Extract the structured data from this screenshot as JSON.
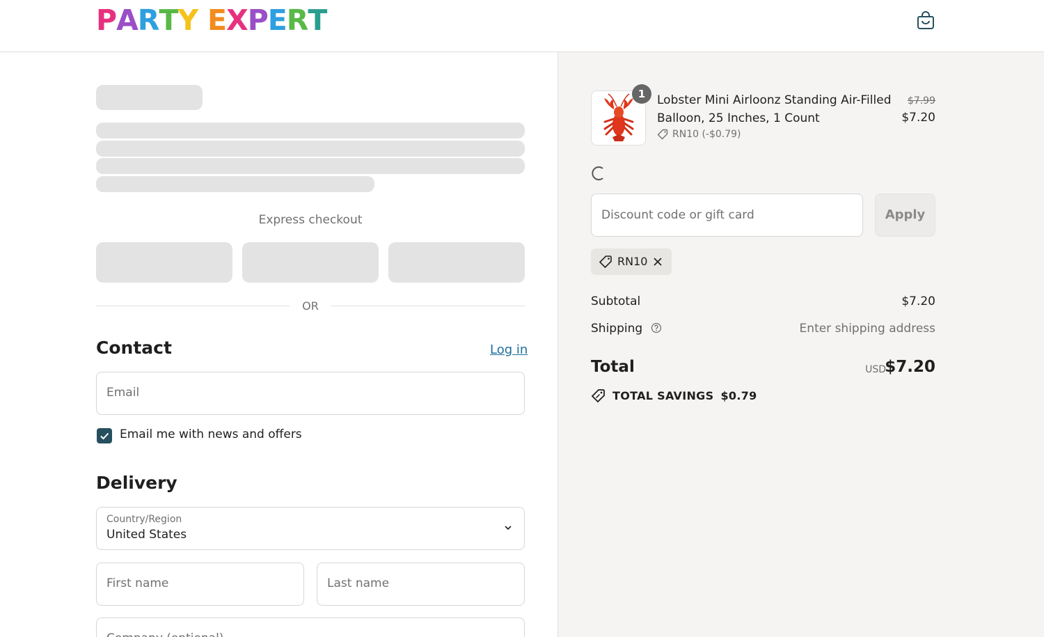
{
  "header": {
    "logo_letters": [
      {
        "ch": "P",
        "color": "#e8317e"
      },
      {
        "ch": "A",
        "color": "#9a4fc7"
      },
      {
        "ch": "R",
        "color": "#2e9fe0"
      },
      {
        "ch": "T",
        "color": "#58b947"
      },
      {
        "ch": "Y",
        "color": "#f5c21b"
      },
      {
        "ch": " ",
        "color": "#ffffff"
      },
      {
        "ch": "E",
        "color": "#f28c1e"
      },
      {
        "ch": "X",
        "color": "#e8317e"
      },
      {
        "ch": "P",
        "color": "#9a4fc7"
      },
      {
        "ch": "E",
        "color": "#2e9fe0"
      },
      {
        "ch": "R",
        "color": "#58b947"
      },
      {
        "ch": "T",
        "color": "#2a9d8f"
      }
    ],
    "cart_icon": "shopping-bag-icon"
  },
  "express": {
    "label": "Express checkout",
    "or_label": "OR"
  },
  "contact": {
    "title": "Contact",
    "login_link": "Log in",
    "email_placeholder": "Email",
    "newsletter_label": "Email me with news and offers",
    "newsletter_checked": true
  },
  "delivery": {
    "title": "Delivery",
    "country_label": "Country/Region",
    "country_value": "United States",
    "first_name_placeholder": "First name",
    "last_name_placeholder": "Last name",
    "company_placeholder": "Company (optional)"
  },
  "order": {
    "item": {
      "quantity": "1",
      "name": "Lobster Mini Airloonz Standing Air-Filled Balloon, 25 Inches, 1 Count",
      "discount_line": "RN10 (-$0.79)",
      "price_original": "$7.99",
      "price_final": "$7.20"
    },
    "discount_placeholder": "Discount code or gift card",
    "apply_label": "Apply",
    "applied_code": "RN10",
    "subtotal_label": "Subtotal",
    "subtotal_value": "$7.20",
    "shipping_label": "Shipping",
    "shipping_value": "Enter shipping address",
    "total_label": "Total",
    "total_currency": "USD",
    "total_value": "$7.20",
    "savings_label": "TOTAL SAVINGS",
    "savings_value": "$0.79"
  },
  "colors": {
    "accent_checkbox": "#26505f",
    "link": "#1d6e9a",
    "right_bg": "#f6f4f2"
  }
}
